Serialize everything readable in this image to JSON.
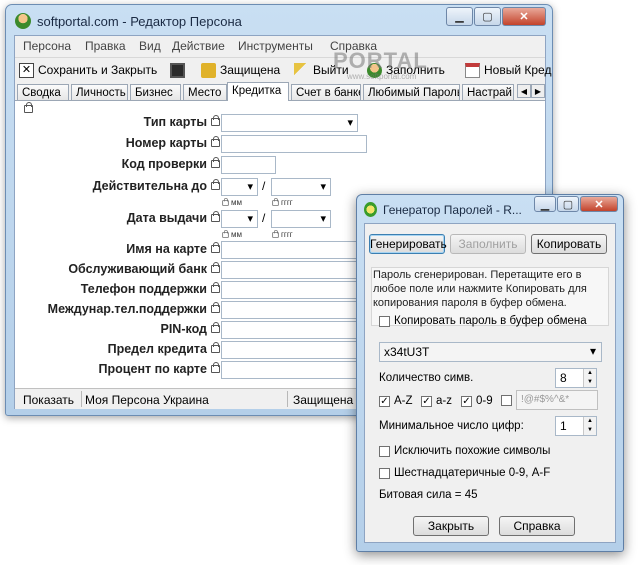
{
  "main": {
    "title": "softportal.com - Редактор Персона",
    "controls": {
      "minimize": "▁",
      "maximize": "▢",
      "close": "✕"
    },
    "menu": [
      "Персона",
      "Правка",
      "Вид",
      "Действие",
      "Инструменты",
      "Справка"
    ],
    "toolbar": {
      "save_close": "Сохранить и Закрыть",
      "protected": "Защищена",
      "logout": "Выйти",
      "fill": "Заполнить",
      "new_card": "Новый Кред"
    },
    "tabs": [
      "Сводка",
      "Личность",
      "Бизнес",
      "Место",
      "Кредитка",
      "Счет в банке",
      "Любимый Пароль",
      "Настрай"
    ],
    "active_tab": "Кредитка",
    "form": {
      "card_type": "Тип карты",
      "card_number": "Номер карты",
      "check_code": "Код проверки",
      "valid_until": "Действительна до",
      "issue_date": "Дата выдачи",
      "mm": "мм",
      "yyyy": "гггг",
      "slash": "/",
      "name_on_card": "Имя на карте",
      "bank": "Обслуживающий банк",
      "support_phone": "Телефон поддержки",
      "intl_support_phone": "Междунар.тел.поддержки",
      "pin": "PIN-код",
      "credit_limit": "Предел кредита",
      "card_rate": "Процент по карте"
    },
    "status": {
      "show": "Показать",
      "persona": "Моя Персона Украина",
      "protected": "Защищена"
    }
  },
  "watermark": {
    "brand": "PORTAL",
    "url": "www.softportal.com"
  },
  "generator": {
    "title": "Генератор Паролей - R...",
    "buttons": {
      "generate": "Генерировать",
      "fill": "Заполнить",
      "copy": "Копировать",
      "close": "Закрыть",
      "help": "Справка"
    },
    "info": "Пароль сгенерирован. Перетащите его в любое поле или нажмите Копировать для копирования пароля в буфер обмена.",
    "copy_to_clipboard": "Копировать пароль в буфер обмена",
    "password": "x34tU3T",
    "length_label": "Количество симв.",
    "length_value": "8",
    "sets": {
      "upper": "A-Z",
      "lower": "a-z",
      "digits": "0-9",
      "symbols": "!@#$%^&*"
    },
    "min_digits_label": "Минимальное число цифр:",
    "min_digits_value": "1",
    "exclude_similar": "Исключить похожие символы",
    "hex": "Шестнадцатеричные 0-9, A-F",
    "strength": "Битовая сила = 45"
  },
  "colors": {
    "title_bar": "#c9dff3",
    "close_button": "#c3432b",
    "focus_border": "#3c7fb1"
  }
}
